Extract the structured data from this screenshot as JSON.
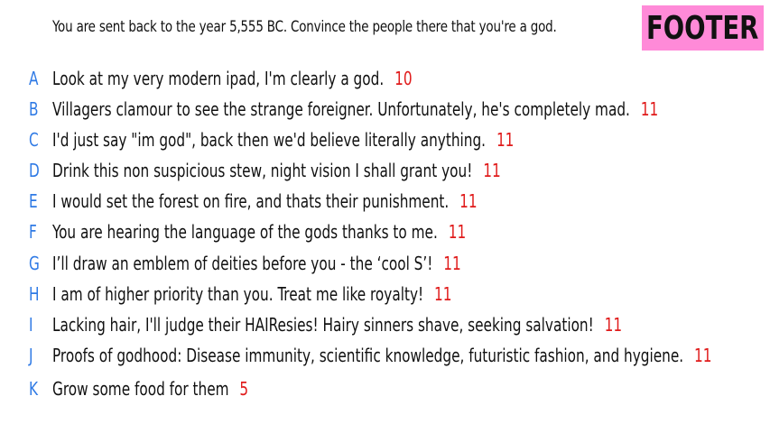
{
  "prompt": "You are sent back to the year 5,555 BC. Convince the people there that you're a god.",
  "footer_label": "FOOTER",
  "answers": [
    {
      "letter": "A",
      "text": "Look at my very modern ipad, I'm clearly a god.",
      "score": "10"
    },
    {
      "letter": "B",
      "text": "Villagers clamour to see the strange foreigner. Unfortunately, he's completely mad.",
      "score": "11"
    },
    {
      "letter": "C",
      "text": "I'd just say \"im god\", back then we'd believe literally anything.",
      "score": "11"
    },
    {
      "letter": "D",
      "text": "Drink this non suspicious stew, night vision I shall grant you!",
      "score": "11"
    },
    {
      "letter": "E",
      "text": "I would set the forest on fire, and thats their punishment.",
      "score": "11"
    },
    {
      "letter": "F",
      "text": "You are hearing the language of the gods thanks to me.",
      "score": "11"
    },
    {
      "letter": "G",
      "text": "I’ll draw an emblem of deities before you - the ‘cool S’!",
      "score": "11"
    },
    {
      "letter": "H",
      "text": "I am of higher priority than you. Treat me like royalty!",
      "score": "11"
    },
    {
      "letter": "I",
      "text": "Lacking hair, I'll judge their HAIResies!  Hairy sinners shave, seeking salvation!",
      "score": "11"
    },
    {
      "letter": "J",
      "text": "Proofs of godhood: Disease immunity, scientific knowledge, futuristic fashion, and hygiene.",
      "score": "11"
    },
    {
      "letter": "K",
      "text": "Grow some food for them",
      "score": "5"
    }
  ],
  "colors": {
    "letter": "#2f7ae5",
    "score": "#e01b1b",
    "footer_bg": "#ff8ad8"
  }
}
